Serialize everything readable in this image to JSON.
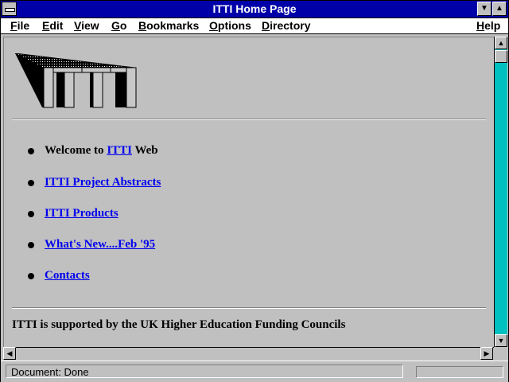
{
  "window": {
    "title": "ITTI Home Page"
  },
  "menu": [
    {
      "label": "File",
      "u": "F",
      "rest": "ile"
    },
    {
      "label": "Edit",
      "u": "E",
      "rest": "dit"
    },
    {
      "label": "View",
      "u": "V",
      "rest": "iew"
    },
    {
      "label": "Go",
      "u": "G",
      "rest": "o"
    },
    {
      "label": "Bookmarks",
      "u": "B",
      "rest": "ookmarks"
    },
    {
      "label": "Options",
      "u": "O",
      "rest": "ptions"
    },
    {
      "label": "Directory",
      "u": "D",
      "rest": "irectory"
    },
    {
      "label": "Help",
      "u": "H",
      "rest": "elp"
    }
  ],
  "page": {
    "logo_text": "ITTI",
    "items": [
      {
        "prefix": "Welcome to ",
        "link": "ITTI",
        "suffix": " Web"
      },
      {
        "prefix": "",
        "link": "ITTI Project Abstracts",
        "suffix": ""
      },
      {
        "prefix": "",
        "link": "ITTI Products",
        "suffix": ""
      },
      {
        "prefix": "",
        "link": "What's New....Feb '95 ",
        "suffix": ""
      },
      {
        "prefix": "",
        "link": "Contacts",
        "suffix": ""
      }
    ],
    "footer": "ITTI is supported by the UK Higher Education Funding Councils"
  },
  "status": {
    "text": "Document: Done",
    "progress": 0
  },
  "colors": {
    "titlebar": "#0000a8",
    "link": "#0000ee",
    "scroll_track": "#00c0c0",
    "chrome": "#c0c0c0"
  },
  "icons": {
    "system_menu": "system-menu-icon",
    "minimize": "minimize-icon",
    "maximize": "maximize-icon",
    "scroll_up": "arrow-up-icon",
    "scroll_down": "arrow-down-icon",
    "scroll_left": "arrow-left-icon",
    "scroll_right": "arrow-right-icon"
  }
}
